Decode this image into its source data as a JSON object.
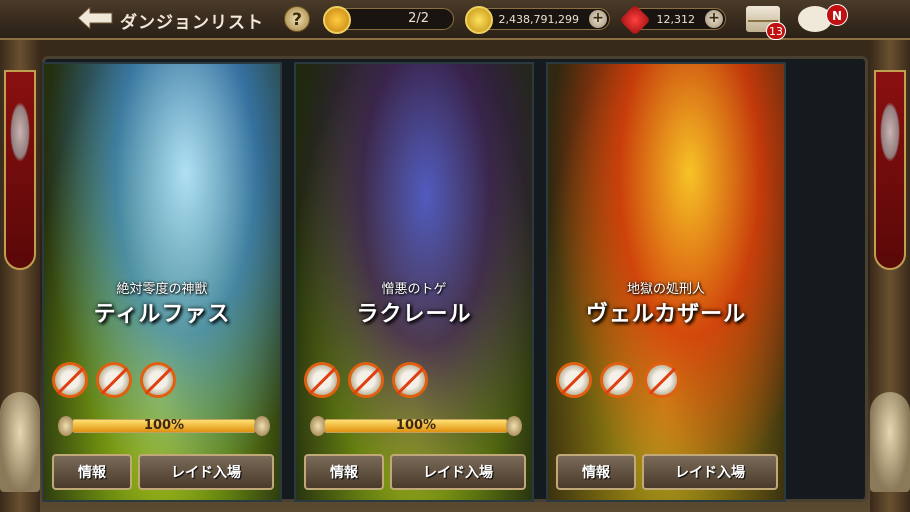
{
  "header": {
    "title": "ダンジョンリスト",
    "help_label": "?",
    "stamina": "2/2",
    "gold": "2,438,791,299",
    "gems": "12,312",
    "plus_label": "+",
    "mail_badge": "13",
    "chat_badge": "N"
  },
  "dungeons": [
    {
      "subtitle": "絶対零度の神獣",
      "name": "ティルファス",
      "progress_label": "100%",
      "progress_value": 1.0,
      "info_label": "情報",
      "raid_label": "レイド入場"
    },
    {
      "subtitle": "憎悪のトゲ",
      "name": "ラクレール",
      "progress_label": "100%",
      "progress_value": 1.0,
      "info_label": "情報",
      "raid_label": "レイド入場"
    },
    {
      "subtitle": "地獄の処刑人",
      "name": "ヴェルカザール",
      "progress_label": "",
      "progress_value": null,
      "info_label": "情報",
      "raid_label": "レイド入場"
    }
  ],
  "colors": {
    "accent": "#c0a878",
    "slot_border": "#e06010"
  }
}
